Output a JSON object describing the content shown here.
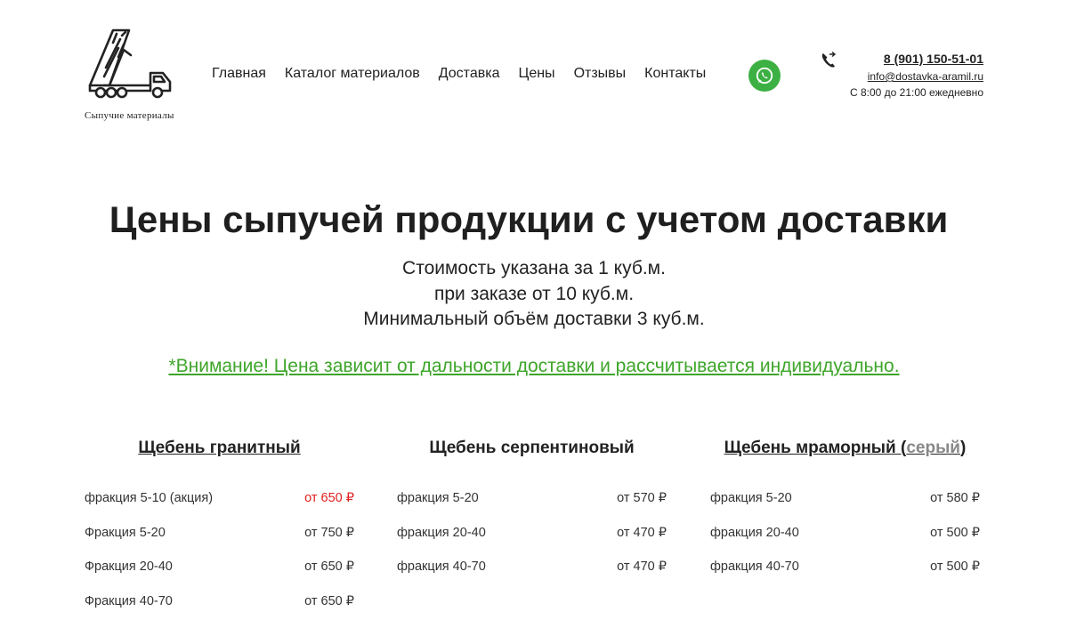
{
  "header": {
    "logo_caption": "Сыпучие материалы",
    "nav": [
      "Главная",
      "Каталог материалов",
      "Доставка",
      "Цены",
      "Отзывы",
      "Контакты"
    ],
    "whatsapp_icon": "whatsapp-icon",
    "phone_icon": "phone-icon",
    "phone": "8 (901) 150-51-01",
    "email": "info@dostavka-aramil.ru",
    "hours": "С 8:00 до 21:00 ежедневно"
  },
  "main": {
    "title": "Цены сыпучей продукции с учетом доставки",
    "subtitles": [
      "Стоимость указана за 1 куб.м.",
      "при заказе от 10 куб.м.",
      "Минимальный объём доставки 3 куб.м."
    ],
    "note": "*Внимание! Цена зависит от дальности доставки и рассчитывается индивидуально.",
    "accent_green": "#3ea52a",
    "accent_red": "#e02020",
    "columns": [
      {
        "title": "Щебень гранитный",
        "rows": [
          {
            "label": "фракция 5-10 (акция)",
            "price": "от 650 ₽",
            "highlight": true
          },
          {
            "label": "Фракция 5-20",
            "price": "от 750 ₽"
          },
          {
            "label": "Фракция 20-40",
            "price": "от 650 ₽"
          },
          {
            "label": "Фракция 40-70",
            "price": "от 650 ₽"
          }
        ]
      },
      {
        "title": "Щебень серпентиновый",
        "rows": [
          {
            "label": "фракция 5-20",
            "price": "от 570 ₽"
          },
          {
            "label": "фракция 20-40",
            "price": "от 470 ₽"
          },
          {
            "label": "фракция 40-70",
            "price": "от 470 ₽"
          }
        ]
      },
      {
        "title_main": "Щебень мраморный (",
        "title_link": "серый",
        "title_end": ")",
        "rows": [
          {
            "label": "фракция 5-20",
            "price": "от 580 ₽"
          },
          {
            "label": "фракция 20-40",
            "price": "от 500 ₽"
          },
          {
            "label": "фракция 40-70",
            "price": "от 500 ₽"
          }
        ]
      }
    ]
  }
}
